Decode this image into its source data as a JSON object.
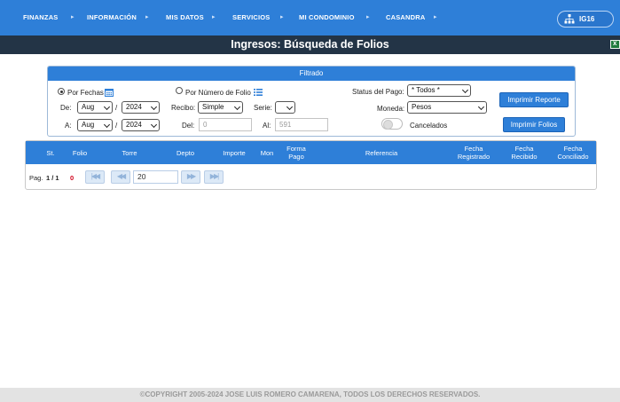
{
  "nav": {
    "items": [
      "FINANZAS",
      "INFORMACIÓN",
      "MIS DATOS",
      "SERVICIOS",
      "MI CONDOMINIO",
      "CASANDRA"
    ],
    "user": {
      "label": "IG16",
      "icon": "sitemap-icon"
    }
  },
  "title": "Ingresos: Búsqueda de Folios",
  "filter": {
    "header": "Filtrado",
    "by_dates_label": "Por Fechas",
    "by_folio_label": "Por Número de Folio",
    "de_label": "De:",
    "a_label": "A:",
    "de_month": "Aug",
    "de_year": "2024",
    "a_month": "Aug",
    "a_year": "2024",
    "slash": "/",
    "recibo_label": "Recibo:",
    "recibo_value": "Simple",
    "serie_label": "Serie:",
    "serie_value": "",
    "del_label": "Del:",
    "del_placeholder": "0",
    "al_label": "Al:",
    "al_placeholder": "591",
    "status_label": "Status del Pago:",
    "status_value": "* Todos *",
    "moneda_label": "Moneda:",
    "moneda_value": "Pesos",
    "cancelados_label": "Cancelados",
    "print_report": "Imprimir Reporte",
    "print_folios": "Imprimir Folios"
  },
  "grid": {
    "columns": [
      "St.",
      "Folio",
      "Torre",
      "Depto",
      "Importe",
      "Mon",
      "Forma Pago",
      "Referencia",
      "Fecha Registrado",
      "Fecha Recibido",
      "Fecha Conciliado"
    ],
    "page_label": "Pag.",
    "page_value": "1 / 1",
    "count": "0",
    "page_size": "20"
  },
  "footer": "©COPYRIGHT 2005-2024 JOSE LUIS ROMERO CAMARENA, TODOS LOS DERECHOS RESERVADOS.",
  "colors": {
    "accent": "#2e7fd8",
    "titlebar": "#233446",
    "count": "#d0021b"
  }
}
